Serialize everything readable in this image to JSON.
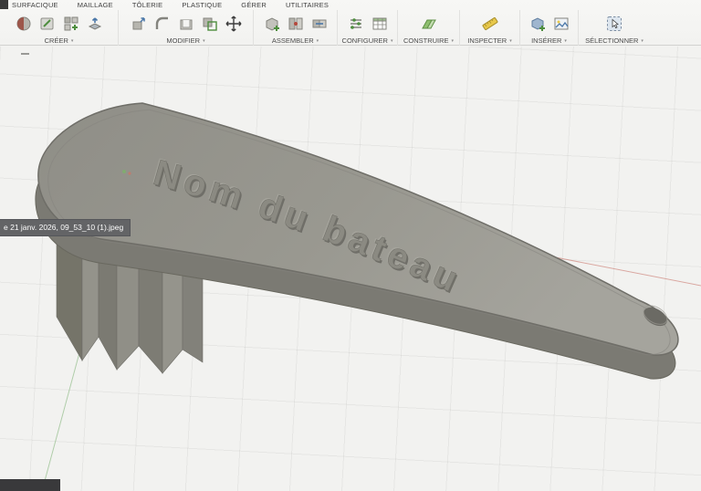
{
  "tabs": [
    "SURFACIQUE",
    "MAILLAGE",
    "TÔLERIE",
    "PLASTIQUE",
    "GÉRER",
    "UTILITAIRES"
  ],
  "toolbar": {
    "caret": "▾",
    "groups": [
      {
        "label": "CRÉER",
        "icons": [
          "create-form-icon",
          "create-sketch-icon",
          "pattern-icon",
          "extrude-icon"
        ]
      },
      {
        "label": "MODIFIER",
        "icons": [
          "press-pull-icon",
          "fillet-icon",
          "shell-icon",
          "combine-icon",
          "move-copy-icon"
        ]
      },
      {
        "label": "ASSEMBLER",
        "icons": [
          "new-component-icon",
          "joint-icon",
          "rigid-group-icon"
        ]
      },
      {
        "label": "CONFIGURER",
        "icons": [
          "configuration-icon",
          "configuration-table-icon"
        ]
      },
      {
        "label": "CONSTRUIRE",
        "icons": [
          "construction-plane-icon"
        ]
      },
      {
        "label": "INSPECTER",
        "icons": [
          "measure-icon"
        ]
      },
      {
        "label": "INSÉRER",
        "icons": [
          "insert-derive-icon",
          "insert-image-icon"
        ]
      },
      {
        "label": "SÉLECTIONNER",
        "icons": [
          "select-icon"
        ]
      }
    ]
  },
  "viewport": {
    "model_text": "Nom du bateau",
    "file_label": "e 21 janv. 2026, 09_53_10 (1).jpeg"
  },
  "colors": {
    "accent_green": "#4e8e3e",
    "axis_red": "#c66a60",
    "axis_green": "#6faa64",
    "model_top": "#98978f",
    "model_side": "#7b7a73",
    "toolbar_bg": "#f6f6f4"
  }
}
